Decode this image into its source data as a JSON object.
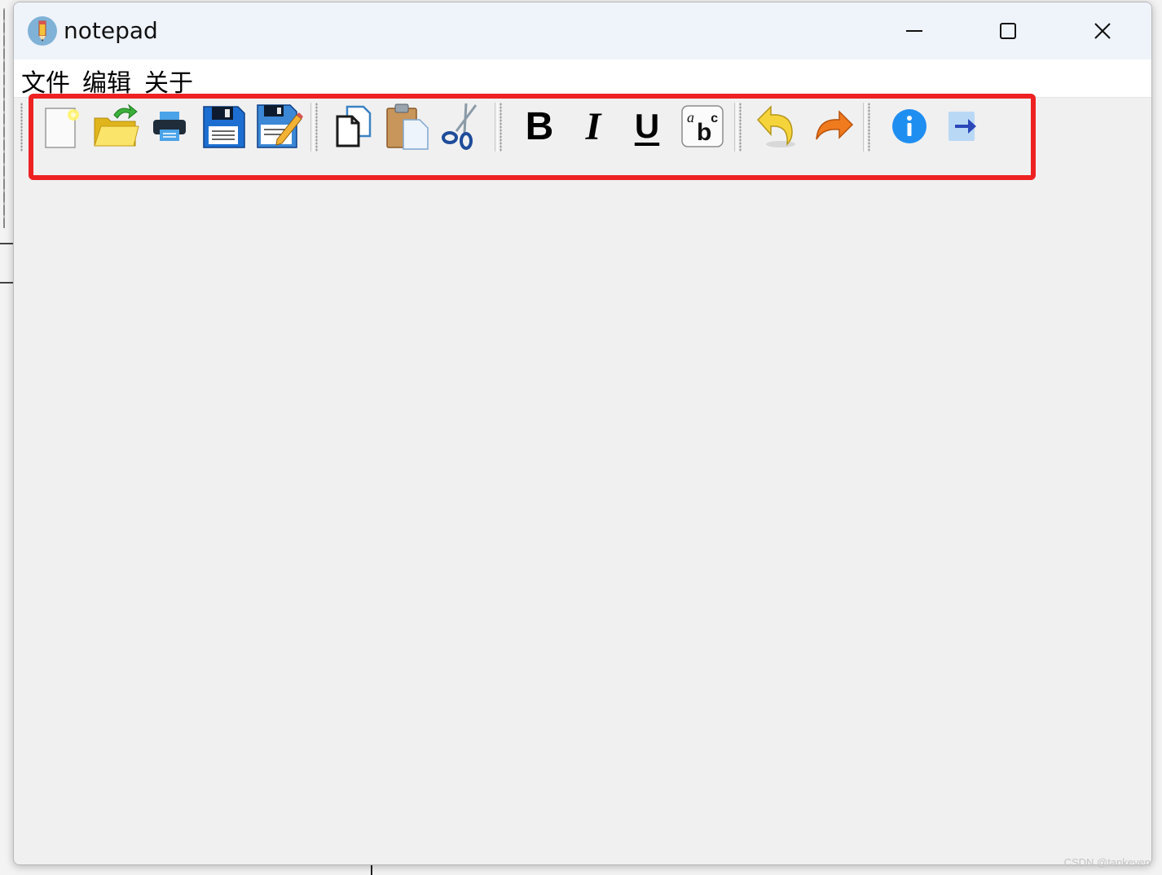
{
  "window": {
    "title": "notepad",
    "controls": {
      "minimize": "minimize-icon",
      "maximize": "maximize-icon",
      "close": "close-icon"
    }
  },
  "menu": {
    "items": [
      {
        "label": "文件"
      },
      {
        "label": "编辑"
      },
      {
        "label": "关于"
      }
    ]
  },
  "toolbar": {
    "highlight_color": "#ee2222",
    "groups": [
      [
        "new-file-icon",
        "open-folder-icon",
        "print-icon",
        "save-icon",
        "save-as-icon"
      ],
      [
        "copy-icon",
        "paste-icon",
        "cut-icon"
      ],
      [
        "bold-icon",
        "italic-icon",
        "underline-icon",
        "font-icon"
      ],
      [
        "undo-icon",
        "redo-icon"
      ],
      [
        "info-icon",
        "exit-arrow-icon"
      ]
    ],
    "bold_glyph": "B",
    "italic_glyph": "I",
    "underline_glyph": "U"
  },
  "watermark": "CSDN @tankeven"
}
